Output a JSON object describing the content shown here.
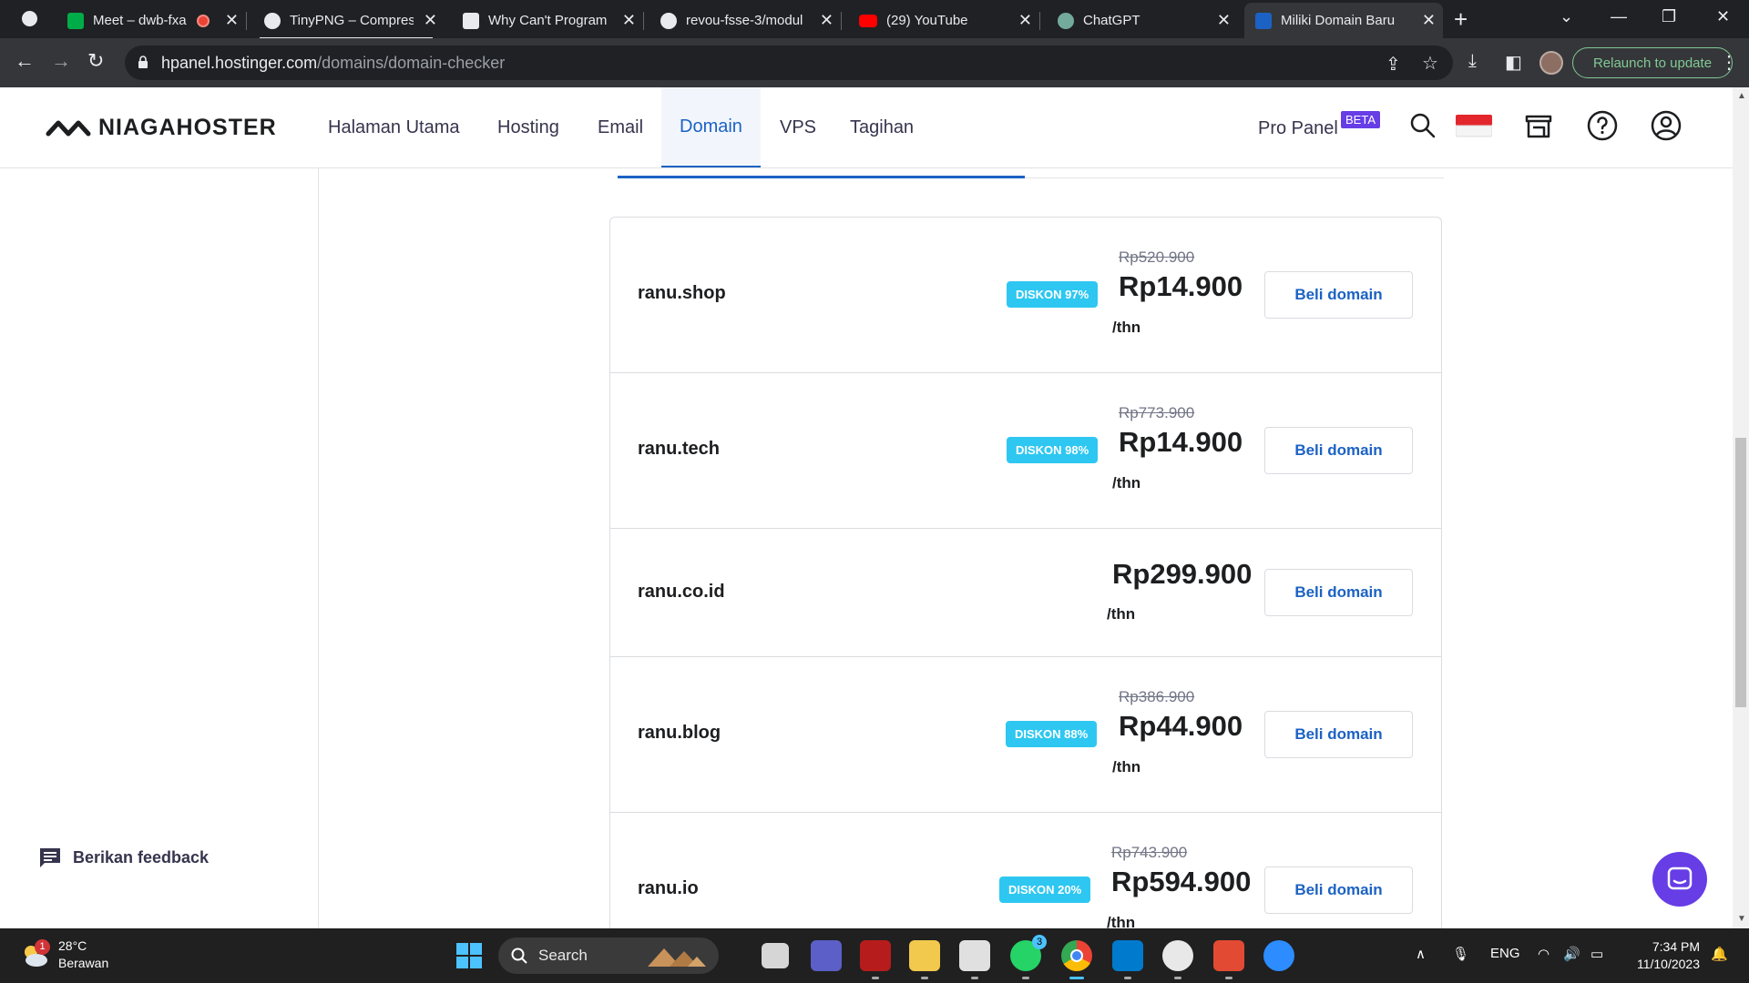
{
  "browser": {
    "tabs": [
      {
        "title": "Meet – dwb-fxa",
        "favicon_color": "#00ac47",
        "recording": true
      },
      {
        "title": "TinyPNG – Compress",
        "favicon_color": "#e8eaed"
      },
      {
        "title": "Why Can't Program",
        "favicon_color": "#e8eaed"
      },
      {
        "title": "revou-fsse-3/modul",
        "favicon_color": "#e8eaed"
      },
      {
        "title": "(29) YouTube",
        "favicon_color": "#ff0000"
      },
      {
        "title": "ChatGPT",
        "favicon_color": "#74aa9c"
      },
      {
        "title": "Miliki Domain Baru",
        "favicon_color": "#1c62c4",
        "active": true
      }
    ],
    "url_host": "hpanel.hostinger.com",
    "url_path": "/domains/domain-checker",
    "relaunch_label": "Relaunch to update"
  },
  "header": {
    "brand": "NIAGAHOSTER",
    "nav": [
      "Halaman Utama",
      "Hosting",
      "Email",
      "Domain",
      "VPS",
      "Tagihan"
    ],
    "active_nav": "Domain",
    "pro_panel": "Pro Panel",
    "beta": "BETA"
  },
  "sidebar": {
    "feedback": "Berikan feedback"
  },
  "results": [
    {
      "domain": "ranu.shop",
      "badge": "DISKON 97%",
      "old_price": "Rp520.900",
      "price": "Rp14.900",
      "per": "/thn",
      "button": "Beli domain"
    },
    {
      "domain": "ranu.tech",
      "badge": "DISKON 98%",
      "old_price": "Rp773.900",
      "price": "Rp14.900",
      "per": "/thn",
      "button": "Beli domain"
    },
    {
      "domain": "ranu.co.id",
      "badge": "",
      "old_price": "",
      "price": "Rp299.900",
      "per": "/thn",
      "button": "Beli domain"
    },
    {
      "domain": "ranu.blog",
      "badge": "DISKON 88%",
      "old_price": "Rp386.900",
      "price": "Rp44.900",
      "per": "/thn",
      "button": "Beli domain"
    },
    {
      "domain": "ranu.io",
      "badge": "DISKON 20%",
      "old_price": "Rp743.900",
      "price": "Rp594.900",
      "per": "/thn",
      "button": "Beli domain"
    }
  ],
  "colors": {
    "brand_accent": "#1c62c4",
    "badge": "#2ec7f1",
    "chat": "#673de6"
  },
  "taskbar": {
    "weather_temp": "28°C",
    "weather_desc": "Berawan",
    "weather_badge": "1",
    "search_label": "Search",
    "whatsapp_badge": "3",
    "lang": "ENG",
    "time": "7:34 PM",
    "date": "11/10/2023"
  }
}
